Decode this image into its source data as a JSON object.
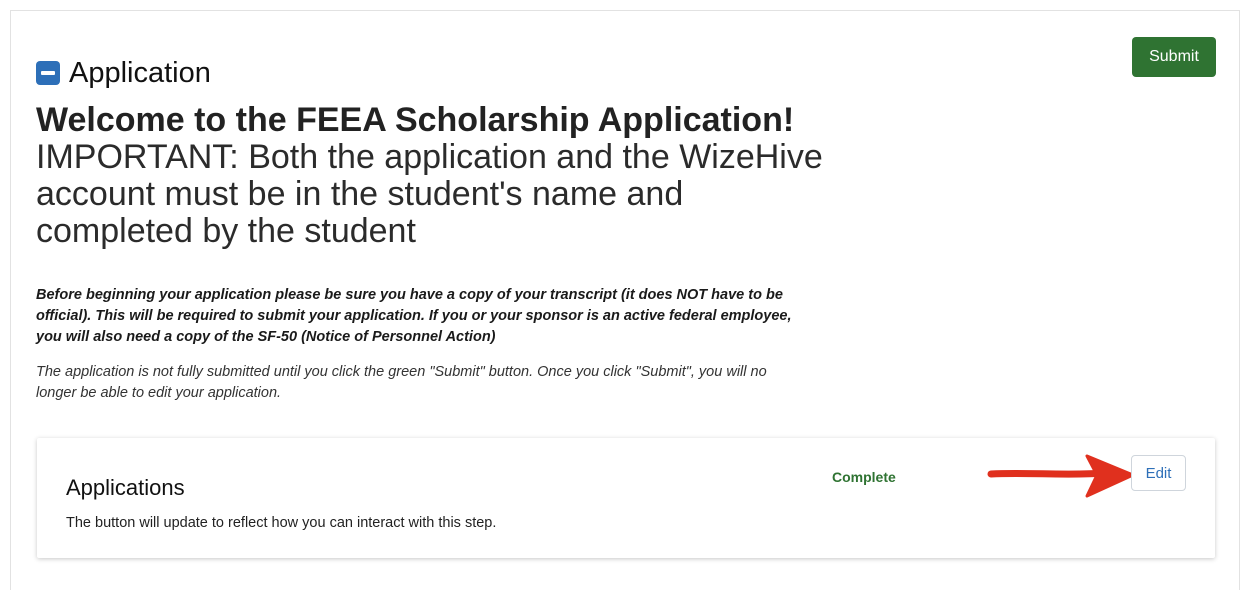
{
  "section": {
    "icon": "collapse-minus-icon",
    "title": "Application"
  },
  "submit_label": "Submit",
  "welcome": {
    "bold": "Welcome to the FEEA Scholarship Application!",
    "rest": " IMPORTANT: Both the application and the WizeHive account must be in the student's name and completed by the student"
  },
  "notice_bold": "Before beginning your application please be sure you have a copy of your transcript (it does NOT have to be official). This will be required to submit your application. If you or your sponsor is an active federal employee, you will also need a copy of the SF-50 (Notice of Personnel Action)",
  "notice_italic": "The application is not fully submitted until you click the green \"Submit\" button. Once you click \"Submit\", you will no longer be able to edit your application.",
  "step": {
    "title": "Applications",
    "description": "The button will update to reflect how you can interact with this step.",
    "status": "Complete",
    "edit_label": "Edit",
    "arrow_icon": "red-arrow-annotation"
  },
  "colors": {
    "submit_green": "#2f7332",
    "status_green": "#2f7332",
    "icon_blue": "#2d6fb8",
    "link_blue": "#2d6fb8",
    "arrow_red": "#e0301e"
  }
}
